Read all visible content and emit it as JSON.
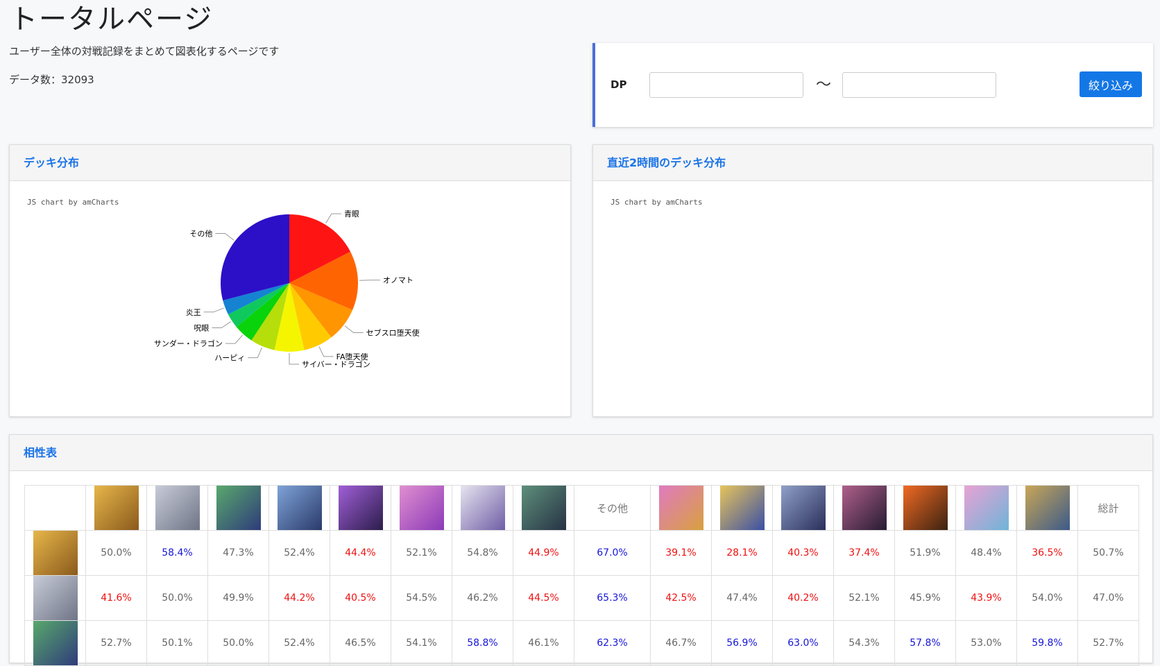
{
  "page": {
    "title": "トータルページ",
    "description": "ユーザー全体の対戦記録をまとめて図表化するページです",
    "count_label": "データ数：32093"
  },
  "filter": {
    "label": "DP",
    "min_value": "",
    "max_value": "",
    "separator": "～",
    "button_label": "絞り込み"
  },
  "deck_panel": {
    "title": "デッキ分布",
    "credit": "JS chart by amCharts"
  },
  "recent_panel": {
    "title": "直近2時間のデッキ分布",
    "credit": "JS chart by amCharts"
  },
  "chart_data": {
    "type": "pie",
    "categories": [
      "青眼",
      "オノマト",
      "セブスロ堕天使",
      "FA堕天使",
      "サイバー・ドラゴン",
      "ハーピィ",
      "サンダー・ドラゴン",
      "呪眼",
      "炎王",
      "その他"
    ],
    "values": [
      15,
      12,
      7,
      6,
      6,
      5,
      4,
      3,
      3,
      25
    ],
    "colors": [
      "#ff1414",
      "#ff6402",
      "#ff9500",
      "#ffcb00",
      "#f5f500",
      "#b6de0a",
      "#09d30a",
      "#0fc95e",
      "#1583d2",
      "#2c10c7"
    ]
  },
  "matchup": {
    "title": "相性表",
    "other_label": "その他",
    "total_label": "総計",
    "header_thumbs": [
      {
        "colors": [
          "#e7b64a",
          "#8a5a1c"
        ],
        "other": false
      },
      {
        "colors": [
          "#c8ccd8",
          "#6f7486"
        ],
        "other": false
      },
      {
        "colors": [
          "#59a86c",
          "#2e3b7a"
        ],
        "other": false
      },
      {
        "colors": [
          "#7fa3d8",
          "#2a3a6a"
        ],
        "other": false
      },
      {
        "colors": [
          "#a15fd8",
          "#2b1d4a"
        ],
        "other": false
      },
      {
        "colors": [
          "#e08fd0",
          "#8b3ab8"
        ],
        "other": false
      },
      {
        "colors": [
          "#e7e4ef",
          "#6f5ea6"
        ],
        "other": false
      },
      {
        "colors": [
          "#5e8f7a",
          "#263245"
        ],
        "other": false
      },
      {
        "colors": [
          "#ffffff",
          "#ffffff"
        ],
        "other": true
      },
      {
        "colors": [
          "#e07ac0",
          "#d8a13e"
        ],
        "other": false
      },
      {
        "colors": [
          "#e7c45a",
          "#3a4fa6"
        ],
        "other": false
      },
      {
        "colors": [
          "#8fa0c8",
          "#2a2f5a"
        ],
        "other": false
      },
      {
        "colors": [
          "#b0608a",
          "#251b33"
        ],
        "other": false
      },
      {
        "colors": [
          "#f06a24",
          "#3a2210"
        ],
        "other": false
      },
      {
        "colors": [
          "#e8a2d4",
          "#6fb4d8"
        ],
        "other": false
      },
      {
        "colors": [
          "#c9a656",
          "#3b5a8a"
        ],
        "other": false
      }
    ],
    "rows": [
      {
        "thumb_colors": [
          "#e7b64a",
          "#8a5a1c"
        ],
        "cells": [
          {
            "v": "50.0%",
            "c": "n"
          },
          {
            "v": "58.4%",
            "c": "hi"
          },
          {
            "v": "47.3%",
            "c": "n"
          },
          {
            "v": "52.4%",
            "c": "n"
          },
          {
            "v": "44.4%",
            "c": "lo"
          },
          {
            "v": "52.1%",
            "c": "n"
          },
          {
            "v": "54.8%",
            "c": "n"
          },
          {
            "v": "44.9%",
            "c": "lo"
          },
          {
            "v": "67.0%",
            "c": "hi"
          },
          {
            "v": "39.1%",
            "c": "lo"
          },
          {
            "v": "28.1%",
            "c": "lo"
          },
          {
            "v": "40.3%",
            "c": "lo"
          },
          {
            "v": "37.4%",
            "c": "lo"
          },
          {
            "v": "51.9%",
            "c": "n"
          },
          {
            "v": "48.4%",
            "c": "n"
          },
          {
            "v": "36.5%",
            "c": "lo"
          },
          {
            "v": "50.7%",
            "c": "n"
          }
        ]
      },
      {
        "thumb_colors": [
          "#c8ccd8",
          "#6f7486"
        ],
        "cells": [
          {
            "v": "41.6%",
            "c": "lo"
          },
          {
            "v": "50.0%",
            "c": "n"
          },
          {
            "v": "49.9%",
            "c": "n"
          },
          {
            "v": "44.2%",
            "c": "lo"
          },
          {
            "v": "40.5%",
            "c": "lo"
          },
          {
            "v": "54.5%",
            "c": "n"
          },
          {
            "v": "46.2%",
            "c": "n"
          },
          {
            "v": "44.5%",
            "c": "lo"
          },
          {
            "v": "65.3%",
            "c": "hi"
          },
          {
            "v": "42.5%",
            "c": "lo"
          },
          {
            "v": "47.4%",
            "c": "n"
          },
          {
            "v": "40.2%",
            "c": "lo"
          },
          {
            "v": "52.1%",
            "c": "n"
          },
          {
            "v": "45.9%",
            "c": "n"
          },
          {
            "v": "43.9%",
            "c": "lo"
          },
          {
            "v": "54.0%",
            "c": "n"
          },
          {
            "v": "47.0%",
            "c": "n"
          }
        ]
      },
      {
        "thumb_colors": [
          "#59a86c",
          "#2e3b7a"
        ],
        "cells": [
          {
            "v": "52.7%",
            "c": "n"
          },
          {
            "v": "50.1%",
            "c": "n"
          },
          {
            "v": "50.0%",
            "c": "n"
          },
          {
            "v": "52.4%",
            "c": "n"
          },
          {
            "v": "46.5%",
            "c": "n"
          },
          {
            "v": "54.1%",
            "c": "n"
          },
          {
            "v": "58.8%",
            "c": "hi"
          },
          {
            "v": "46.1%",
            "c": "n"
          },
          {
            "v": "62.3%",
            "c": "hi"
          },
          {
            "v": "46.7%",
            "c": "n"
          },
          {
            "v": "56.9%",
            "c": "hi"
          },
          {
            "v": "63.0%",
            "c": "hi"
          },
          {
            "v": "54.3%",
            "c": "n"
          },
          {
            "v": "57.8%",
            "c": "hi"
          },
          {
            "v": "53.0%",
            "c": "n"
          },
          {
            "v": "59.8%",
            "c": "hi"
          },
          {
            "v": "52.7%",
            "c": "n"
          }
        ]
      }
    ]
  }
}
